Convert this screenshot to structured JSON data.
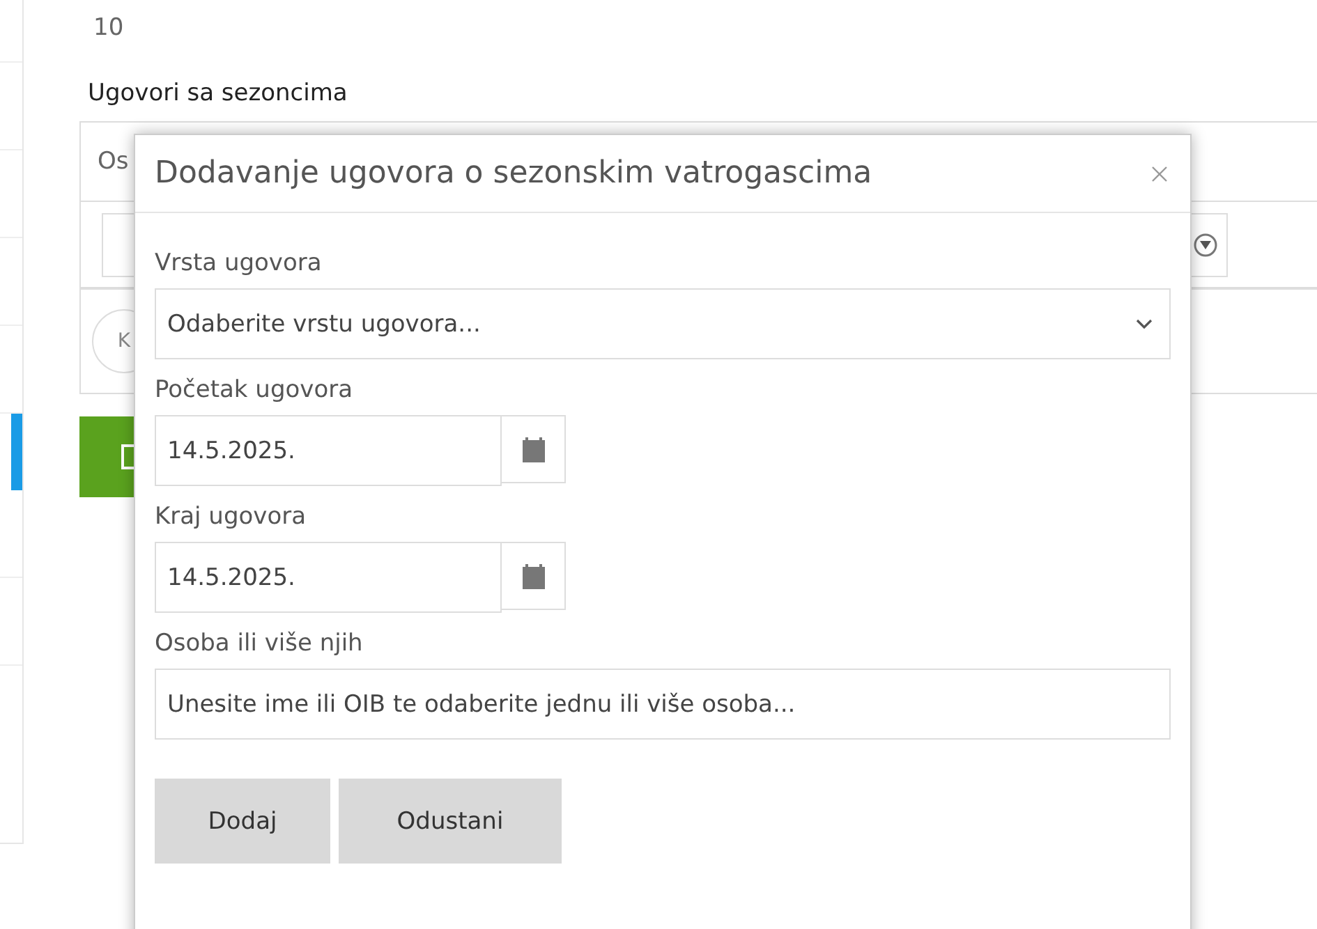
{
  "page": {
    "count": "10",
    "section_title": "Ugovori sa sezoncima",
    "table": {
      "header_fragment": "Os",
      "pager_button": "K"
    }
  },
  "dialog": {
    "title": "Dodavanje ugovora o sezonskim vatrogascima",
    "fields": [
      {
        "kind": "select",
        "label": "Vrsta ugovora",
        "placeholder": "Odaberite vrstu ugovora..."
      },
      {
        "kind": "date",
        "label": "Početak ugovora",
        "value": "14.5.2025."
      },
      {
        "kind": "date",
        "label": "Kraj ugovora",
        "value": "14.5.2025."
      },
      {
        "kind": "text",
        "label": "Osoba ili više njih",
        "placeholder": "Unesite ime ili OIB te odaberite jednu ili više osoba..."
      }
    ],
    "buttons": [
      "Dodaj",
      "Odustani"
    ]
  }
}
